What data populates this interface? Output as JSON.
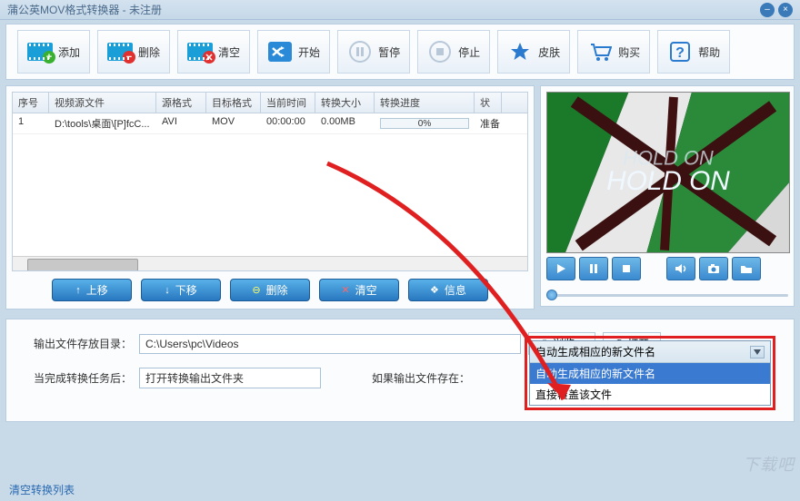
{
  "title": "蒲公英MOV格式转换器 - 未注册",
  "toolbar": {
    "add": "添加",
    "delete": "删除",
    "clear": "清空",
    "start": "开始",
    "pause": "暂停",
    "stop": "停止",
    "skin": "皮肤",
    "buy": "购买",
    "help": "帮助"
  },
  "table": {
    "headers": {
      "seq": "序号",
      "source": "视频源文件",
      "srcFormat": "源格式",
      "tgtFormat": "目标格式",
      "curTime": "当前时间",
      "convSize": "转换大小",
      "progress": "转换进度",
      "status": "状"
    },
    "rows": [
      {
        "seq": "1",
        "source": "D:\\tools\\桌面\\[P]fcC...",
        "srcFormat": "AVI",
        "tgtFormat": "MOV",
        "curTime": "00:00:00",
        "convSize": "0.00MB",
        "progress": "0%",
        "status": "准备"
      }
    ]
  },
  "listActions": {
    "moveUp": "上移",
    "moveDown": "下移",
    "delete": "删除",
    "clear": "清空",
    "info": "信息"
  },
  "output": {
    "dirLabel": "输出文件存放目录：",
    "dirValue": "C:\\Users\\pc\\Videos",
    "browse": "浏览...",
    "open": "打开",
    "afterLabel": "当完成转换任务后：",
    "afterValue": "打开转换输出文件夹",
    "existsLabel": "如果输出文件存在：",
    "existsSelected": "自动生成相应的新文件名",
    "existsOptions": [
      "自动生成相应的新文件名",
      "直接覆盖该文件"
    ]
  },
  "preview": {
    "text1": "HOLD ON",
    "text2": "HOLD ON"
  },
  "footer": {
    "clearList": "清空转换列表"
  },
  "watermark": "下载吧"
}
